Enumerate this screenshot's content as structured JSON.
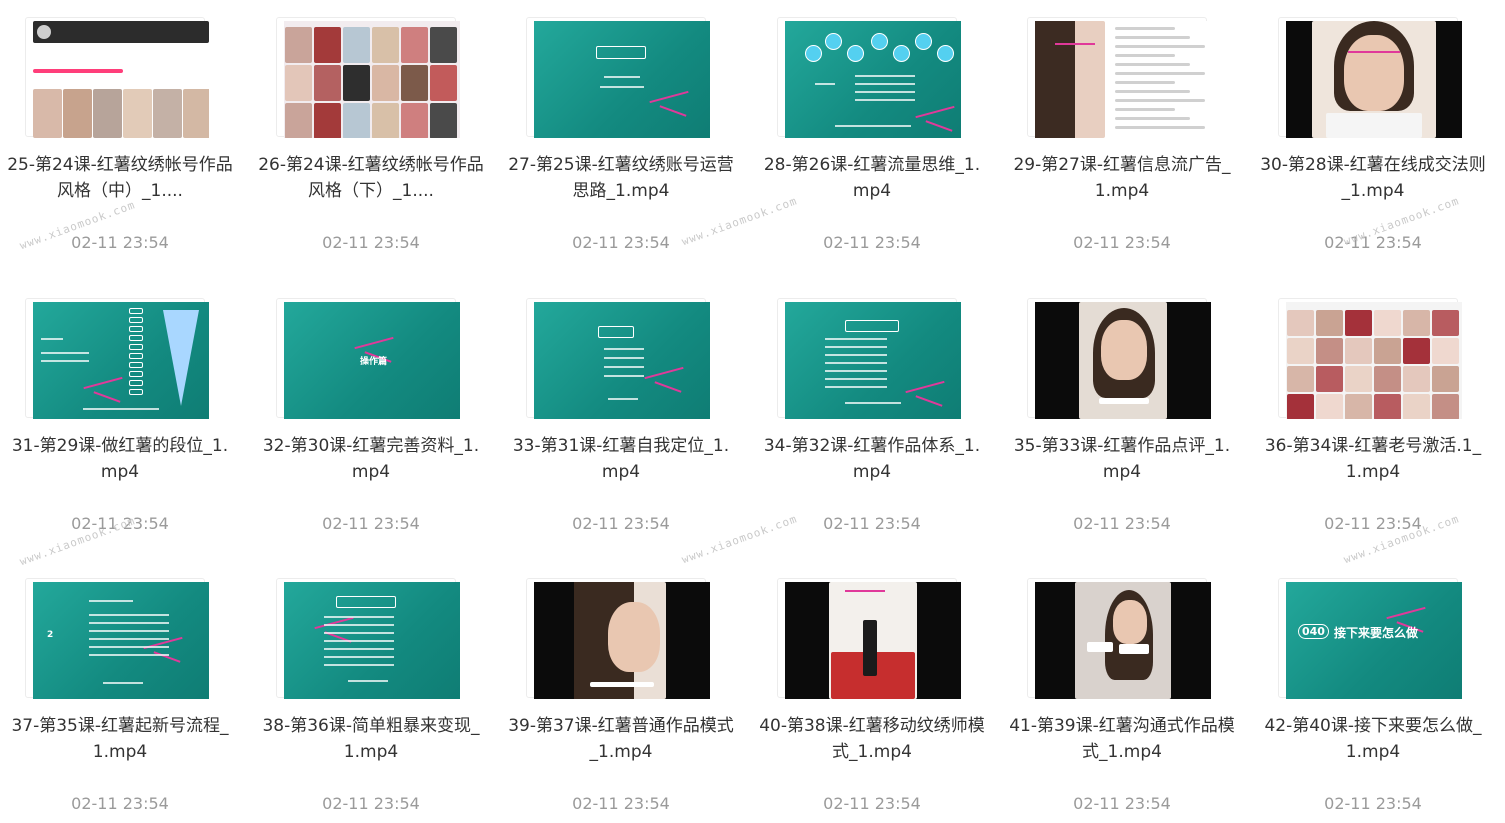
{
  "watermark_text": "www.xiaomook.com",
  "files": [
    {
      "title": "25-第24课-红薯纹绣帐号作品风格（中）_1....",
      "date": "02-11 23:54",
      "thumb_icon": "screenshot-thumb"
    },
    {
      "title": "26-第24课-红薯纹绣帐号作品风格（下）_1....",
      "date": "02-11 23:54",
      "thumb_icon": "photo-grid-thumb"
    },
    {
      "title": "27-第25课-红薯纹绣账号运营思路_1.mp4",
      "date": "02-11 23:54",
      "thumb_icon": "slide-thumb"
    },
    {
      "title": "28-第26课-红薯流量思维_1.mp4",
      "date": "02-11 23:54",
      "thumb_icon": "slide-thumb"
    },
    {
      "title": "29-第27课-红薯信息流广告_1.mp4",
      "date": "02-11 23:54",
      "thumb_icon": "screenshot-thumb"
    },
    {
      "title": "30-第28课-红薯在线成交法则_1.mp4",
      "date": "02-11 23:54",
      "thumb_icon": "portrait-thumb"
    },
    {
      "title": "31-第29课-做红薯的段位_1.mp4",
      "date": "02-11 23:54",
      "thumb_icon": "slide-thumb"
    },
    {
      "title": "32-第30课-红薯完善资料_1.mp4",
      "date": "02-11 23:54",
      "thumb_icon": "slide-thumb"
    },
    {
      "title": "33-第31课-红薯自我定位_1.mp4",
      "date": "02-11 23:54",
      "thumb_icon": "slide-thumb"
    },
    {
      "title": "34-第32课-红薯作品体系_1.mp4",
      "date": "02-11 23:54",
      "thumb_icon": "slide-thumb"
    },
    {
      "title": "35-第33课-红薯作品点评_1.mp4",
      "date": "02-11 23:54",
      "thumb_icon": "portrait-thumb"
    },
    {
      "title": "36-第34课-红薯老号激活.1_1.mp4",
      "date": "02-11 23:54",
      "thumb_icon": "photo-grid-thumb"
    },
    {
      "title": "37-第35课-红薯起新号流程_1.mp4",
      "date": "02-11 23:54",
      "thumb_icon": "slide-thumb"
    },
    {
      "title": "38-第36课-简单粗暴来变现_1.mp4",
      "date": "02-11 23:54",
      "thumb_icon": "slide-thumb"
    },
    {
      "title": "39-第37课-红薯普通作品模式_1.mp4",
      "date": "02-11 23:54",
      "thumb_icon": "portrait-thumb"
    },
    {
      "title": "40-第38课-红薯移动纹绣师模式_1.mp4",
      "date": "02-11 23:54",
      "thumb_icon": "portrait-thumb"
    },
    {
      "title": "41-第39课-红薯沟通式作品模式_1.mp4",
      "date": "02-11 23:54",
      "thumb_icon": "portrait-thumb"
    },
    {
      "title": "42-第40课-接下来要怎么做_1.mp4",
      "date": "02-11 23:54",
      "thumb_icon": "slide-thumb"
    }
  ],
  "thumb_text": {
    "slide_040_number": "040",
    "slide_040_caption": "接下来要怎么做",
    "slide_32_label": "操作篇",
    "slide_37_number": "2"
  }
}
